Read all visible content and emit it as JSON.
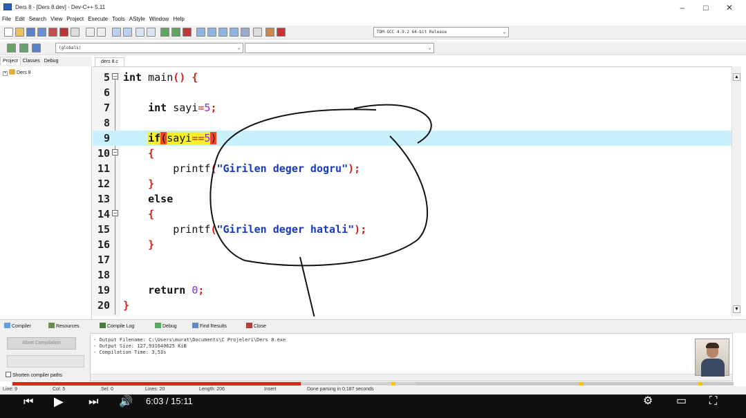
{
  "window": {
    "title": "Ders 8 - [Ders 8.dev] - Dev-C++ 5.11",
    "minimize": "–",
    "maximize": "□",
    "close": "✕"
  },
  "menu": [
    "File",
    "Edit",
    "Search",
    "View",
    "Project",
    "Execute",
    "Tools",
    "AStyle",
    "Window",
    "Help"
  ],
  "toolbar": {
    "compiler_select": "TDM-GCC 4.9.2 64-bit Release",
    "scope_select": "(globals)"
  },
  "left_tabs": [
    "Project",
    "Classes",
    "Debug"
  ],
  "project_tree": {
    "item": "Ders 8",
    "expander": "+"
  },
  "editor": {
    "tab": "ders 8.c",
    "lines": [
      {
        "n": "5"
      },
      {
        "n": "6"
      },
      {
        "n": "7"
      },
      {
        "n": "8"
      },
      {
        "n": "9"
      },
      {
        "n": "10"
      },
      {
        "n": "11"
      },
      {
        "n": "12"
      },
      {
        "n": "13"
      },
      {
        "n": "14"
      },
      {
        "n": "15"
      },
      {
        "n": "16"
      },
      {
        "n": "17"
      },
      {
        "n": "18"
      },
      {
        "n": "19"
      },
      {
        "n": "20"
      }
    ],
    "tokens": {
      "int": "int",
      "main": " main",
      "main_parens": "()",
      "open_brace": "{",
      "close_brace": "}",
      "sayi": " sayi",
      "assign": "=",
      "five": "5",
      "semicolon": ";",
      "if": "if",
      "lparen": "(",
      "sayi_cond": "sayi",
      "eqeq": "==",
      "rparen": ")",
      "printf": "printf",
      "str_dogru": "\"Girilen deger dogru\"",
      "str_hatali": "\"Girilen deger hatali\"",
      "else": "else",
      "return": "return",
      "zero": "0"
    }
  },
  "bottom_tabs": [
    "Compiler",
    "Resources",
    "Compile Log",
    "Debug",
    "Find Results",
    "Close"
  ],
  "compile_panel": {
    "abort_button": "Abort Compilation",
    "shorten_label": "Shorten compiler paths",
    "log": [
      "- Output Filename: C:\\Users\\murat\\Documents\\C Projeleri\\Ders 8.exe",
      "- Output Size: 127,931640625 KiB",
      "- Compilation Time: 3,53s"
    ]
  },
  "status": {
    "line": "Line:  9",
    "col": "Col:  5",
    "sel": "Sel:  0",
    "lines": "Lines:  20",
    "length": "Length:  206",
    "mode": "Insert",
    "message": "Done parsing in 0,187 seconds"
  },
  "video": {
    "time": "6:03 / 15:11",
    "progress_fraction": 0.4,
    "loaded_fraction": 0.56,
    "accent": "#e62117"
  }
}
